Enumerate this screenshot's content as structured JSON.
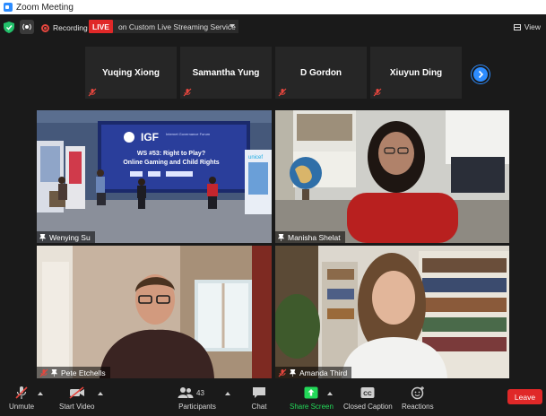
{
  "window": {
    "title": "Zoom Meeting"
  },
  "topbar": {
    "recording_label": "Recording",
    "live_badge": "LIVE",
    "stream_service": "on Custom Live Streaming Service",
    "view_label": "View"
  },
  "filmstrip": {
    "participants": [
      {
        "name": "Yuqing Xiong"
      },
      {
        "name": "Samantha Yung"
      },
      {
        "name": "D Gordon"
      },
      {
        "name": "Xiuyun Ding"
      }
    ]
  },
  "gallery": {
    "tiles": [
      {
        "name": "Wenying Su"
      },
      {
        "name": "Manisha Shelat"
      },
      {
        "name": "Pete Etchells"
      },
      {
        "name": "Amanda Third"
      }
    ],
    "stage_screen": {
      "logo": "IGF",
      "logo_sub": "Internet Governance Forum",
      "headline_line1": "WS #53: Right to Play?",
      "headline_line2": "Online Gaming and Child Rights",
      "sponsor": "unicef"
    }
  },
  "toolbar": {
    "unmute": "Unmute",
    "start_video": "Start Video",
    "participants_label": "Participants",
    "participants_count": "43",
    "chat": "Chat",
    "share_screen": "Share Screen",
    "closed_caption": "Closed Caption",
    "reactions": "Reactions",
    "leave": "Leave"
  },
  "colors": {
    "live_red": "#e02828",
    "zoom_blue": "#2d8cff",
    "share_green": "#23d959",
    "muted_red": "#e5463e"
  }
}
